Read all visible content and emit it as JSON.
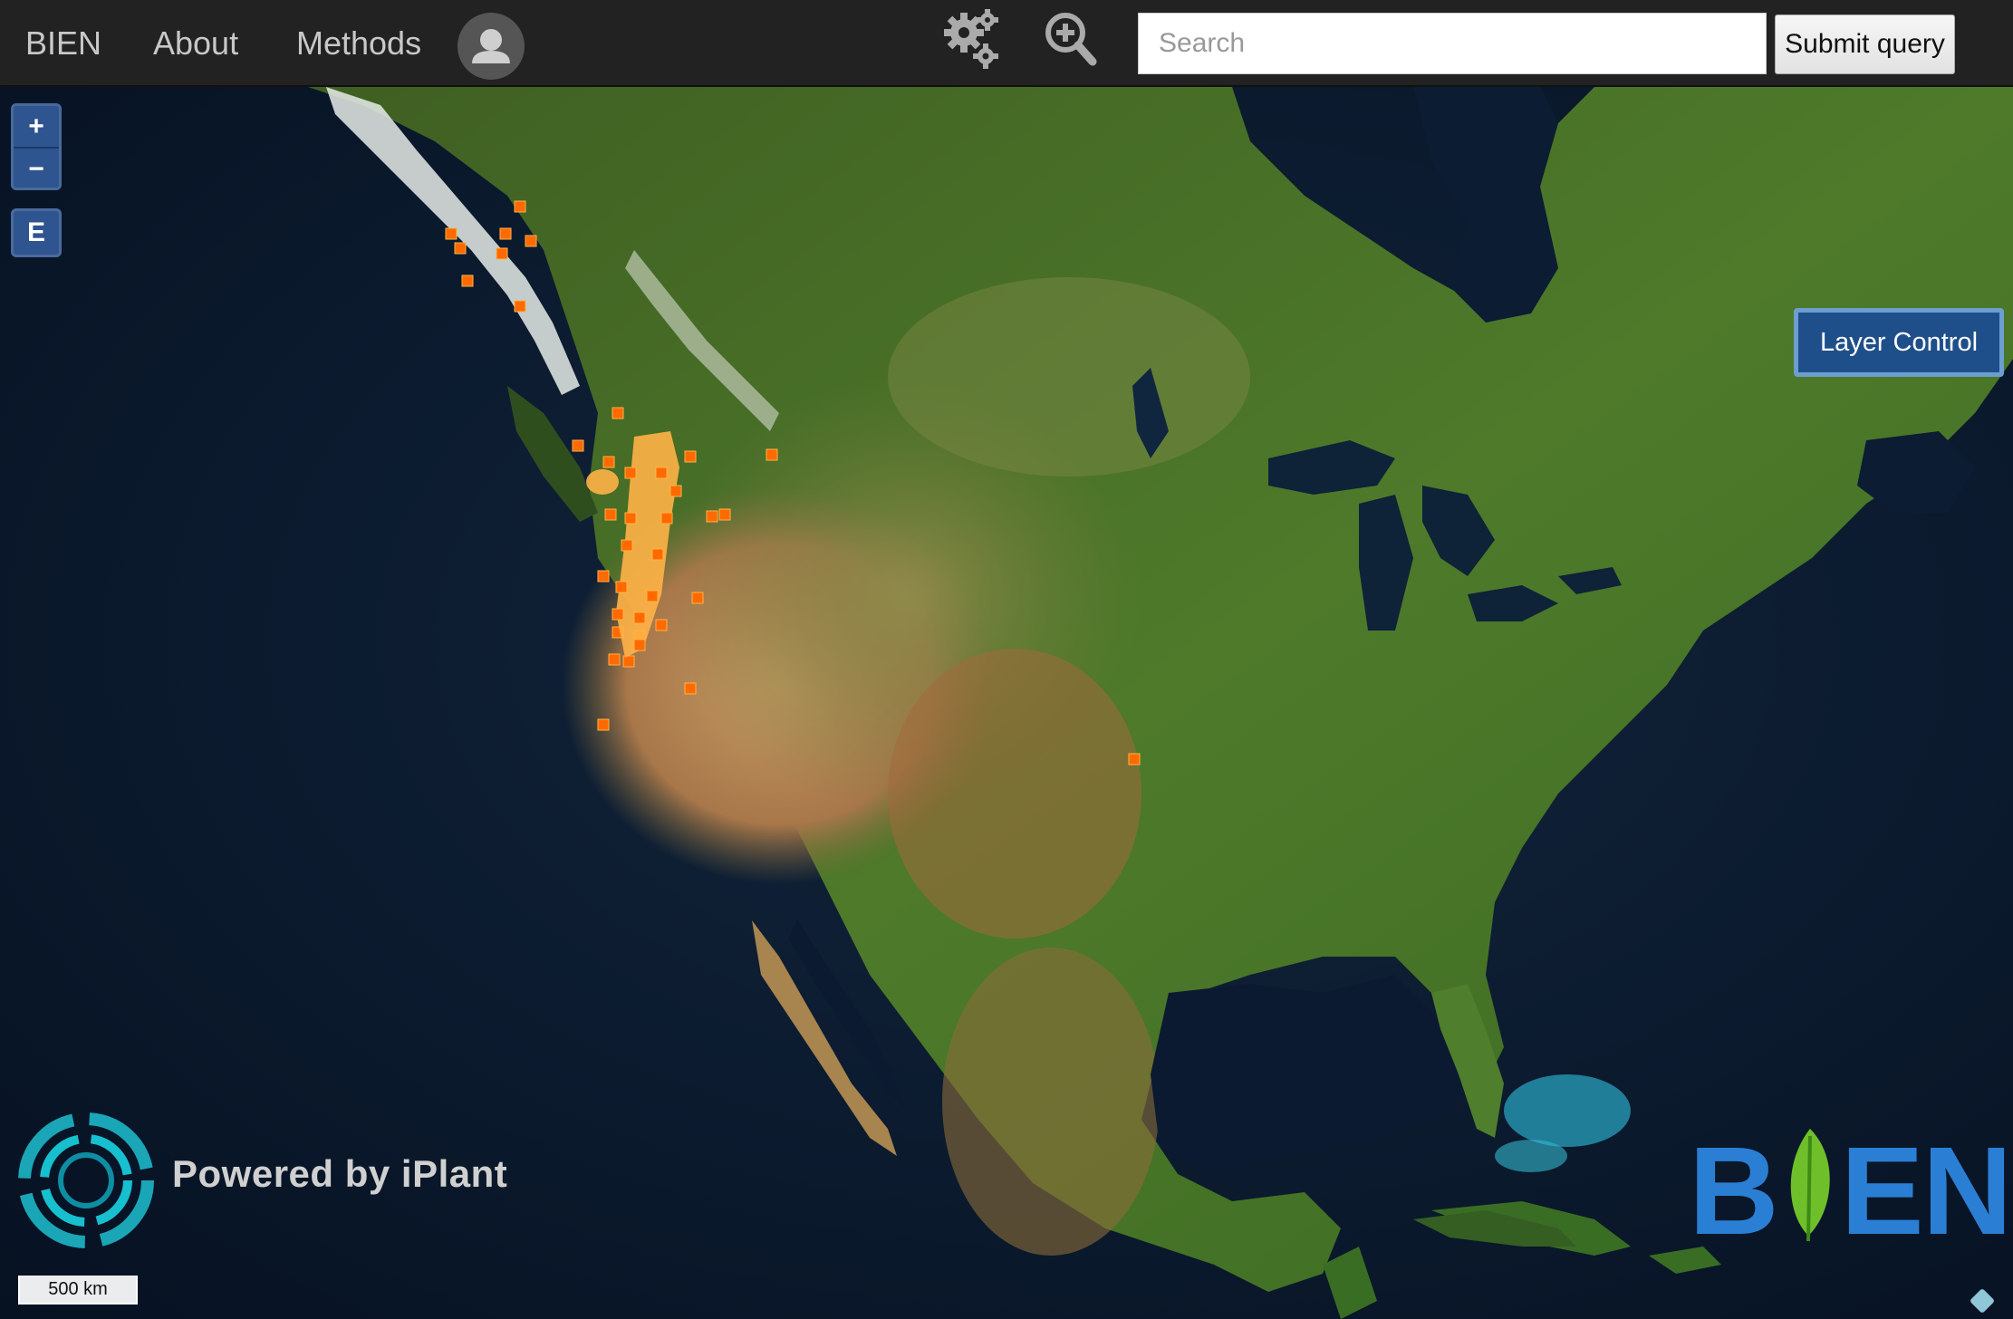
{
  "navbar": {
    "brand": "BIEN",
    "links": [
      "About",
      "Methods"
    ],
    "user_icon": "user-icon",
    "tools": [
      {
        "name": "settings",
        "icon": "gears-icon"
      },
      {
        "name": "zoom",
        "icon": "zoom-in-icon"
      }
    ],
    "search": {
      "value": "",
      "placeholder": "Search"
    },
    "submit_label": "Submit query"
  },
  "map": {
    "zoom_controls": {
      "in": "+",
      "out": "−"
    },
    "extent_button": "E",
    "layer_control_label": "Layer Control",
    "scale_label": "500 km",
    "region": "North America",
    "occurrence_color": "#ff6a00",
    "occurrence_highlight_color": "#ffb347"
  },
  "footer_logos": {
    "iplant_text": "Powered by iPlant",
    "bien_letters": [
      "B",
      "EN"
    ],
    "bien_color": "#1c72c9",
    "leaf_color": "#6fbf2a"
  },
  "icons": {
    "attribution": "attribution-icon"
  }
}
